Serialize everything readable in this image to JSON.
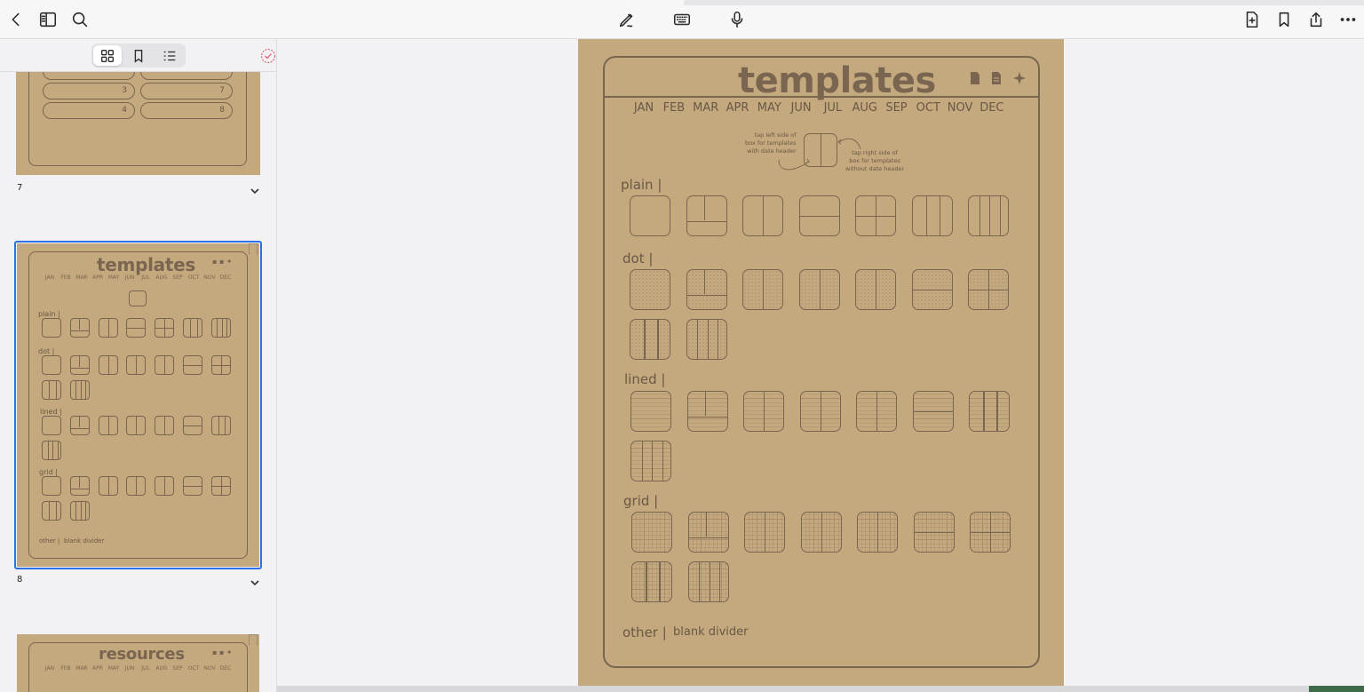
{
  "toolbar": {
    "back_icon": "chevron-left-icon",
    "sidebar_icon": "sidebar-toggle-icon",
    "search_icon": "search-icon",
    "pen_icon": "pencil-icon",
    "keyboard_icon": "keyboard-icon",
    "mic_icon": "microphone-icon",
    "add_page_icon": "add-page-icon",
    "bookmark_icon": "bookmark-icon",
    "share_icon": "share-icon",
    "more_icon": "more-icon"
  },
  "sidebar": {
    "segments": [
      "grid-view-icon",
      "bookmarks-icon",
      "outline-icon"
    ],
    "active_segment": 0,
    "thumb7": {
      "pills": [
        "3",
        "4",
        "7",
        "8"
      ],
      "number": "7"
    },
    "thumb8": {
      "title": "templates",
      "months": [
        "JAN",
        "FEB",
        "MAR",
        "APR",
        "MAY",
        "JUN",
        "JUL",
        "AUG",
        "SEP",
        "OCT",
        "NOV",
        "DEC"
      ],
      "labels": [
        "plain |",
        "dot |",
        "lined |",
        "grid |"
      ],
      "other": "other |",
      "other_link": "blank divider",
      "number": "8"
    },
    "thumb9": {
      "title": "resources",
      "months": [
        "JAN",
        "FEB",
        "MAR",
        "APR",
        "MAY",
        "JUN",
        "JUL",
        "AUG",
        "SEP",
        "OCT",
        "NOV",
        "DEC"
      ]
    }
  },
  "page": {
    "title": "templates",
    "months": [
      "JAN",
      "FEB",
      "MAR",
      "APR",
      "MAY",
      "JUN",
      "JUL",
      "AUG",
      "SEP",
      "OCT",
      "NOV",
      "DEC"
    ],
    "note_left": [
      "tap left side of",
      "box for templates",
      "with date header"
    ],
    "note_right": [
      "tap right side of",
      "box for templates",
      "without date header"
    ],
    "sections": {
      "plain": "plain |",
      "dot": "dot |",
      "lined": "lined |",
      "grid": "grid |"
    },
    "other_label": "other |",
    "other_link": "blank divider"
  },
  "colors": {
    "paper": "#c4a97f",
    "ink": "#7a6650",
    "selection": "#2f6fe8"
  }
}
